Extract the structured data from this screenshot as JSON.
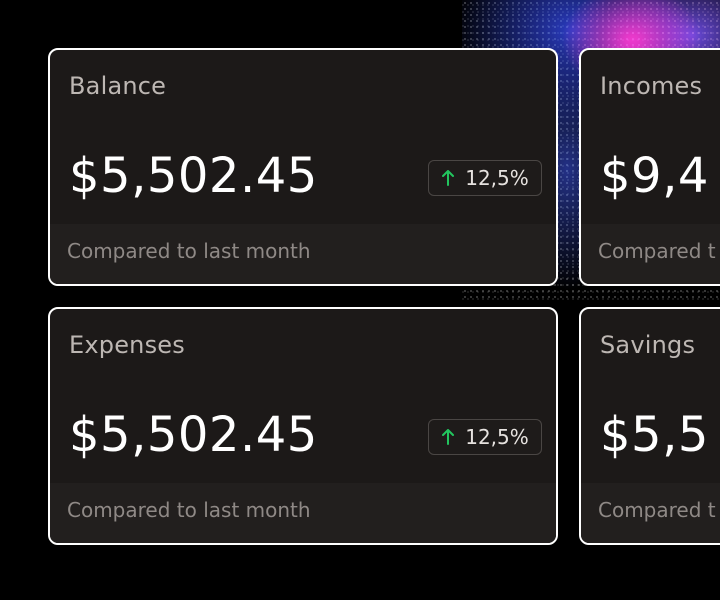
{
  "cards": [
    {
      "title": "Balance",
      "value": "$5,502.45",
      "change": "12,5%",
      "footer": "Compared to last month"
    },
    {
      "title": "Incomes",
      "value": "$9,4",
      "footer": "Compared t"
    },
    {
      "title": "Expenses",
      "value": "$5,502.45",
      "change": "12,5%",
      "footer": "Compared to last month"
    },
    {
      "title": "Savings",
      "value": "$5,5",
      "footer": "Compared t"
    }
  ],
  "colors": {
    "background": "#000000",
    "card_background": "#1c1918",
    "card_footer": "#221f1e",
    "card_border": "#ffffff",
    "title_text": "#bdb7b3",
    "value_text": "#ffffff",
    "footer_text": "#8f8986",
    "badge_border": "#4a4644",
    "positive_accent": "#22c55e"
  },
  "icons": {
    "change_indicator": "up-arrow-icon"
  }
}
